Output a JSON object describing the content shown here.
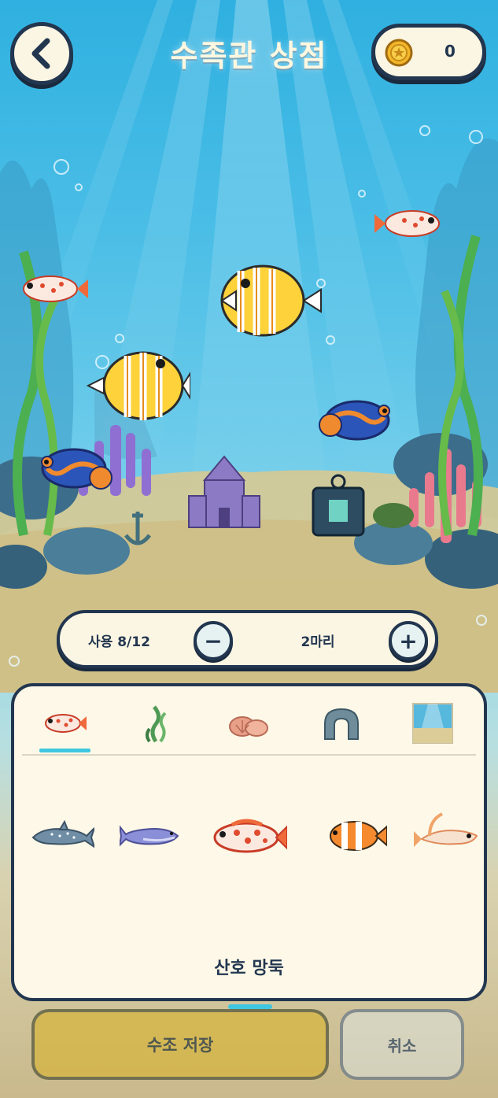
{
  "header": {
    "title": "수족관 상점",
    "coins": "0"
  },
  "counter": {
    "usage": "사용 8/12",
    "quantity": "2마리",
    "minus_label": "−",
    "plus_label": "+"
  },
  "shop": {
    "tabs": [
      {
        "icon": "fish-icon",
        "selected": true
      },
      {
        "icon": "seaweed-icon",
        "selected": false
      },
      {
        "icon": "shell-icon",
        "selected": false
      },
      {
        "icon": "rock-arch-icon",
        "selected": false
      },
      {
        "icon": "background-icon",
        "selected": false
      }
    ],
    "items": [
      {
        "icon": "whale-shark-icon"
      },
      {
        "icon": "blue-whale-icon"
      },
      {
        "icon": "coral-goby-icon",
        "selected": true
      },
      {
        "icon": "clownfish-icon"
      },
      {
        "icon": "goby-icon"
      }
    ],
    "selected_name": "산호 망둑"
  },
  "footer": {
    "save_label": "수조 저장",
    "cancel_label": "취소"
  },
  "colors": {
    "outline": "#22364f",
    "panel": "#fdf8e7",
    "accent": "#3fc6e0",
    "save": "#d6b43c"
  }
}
